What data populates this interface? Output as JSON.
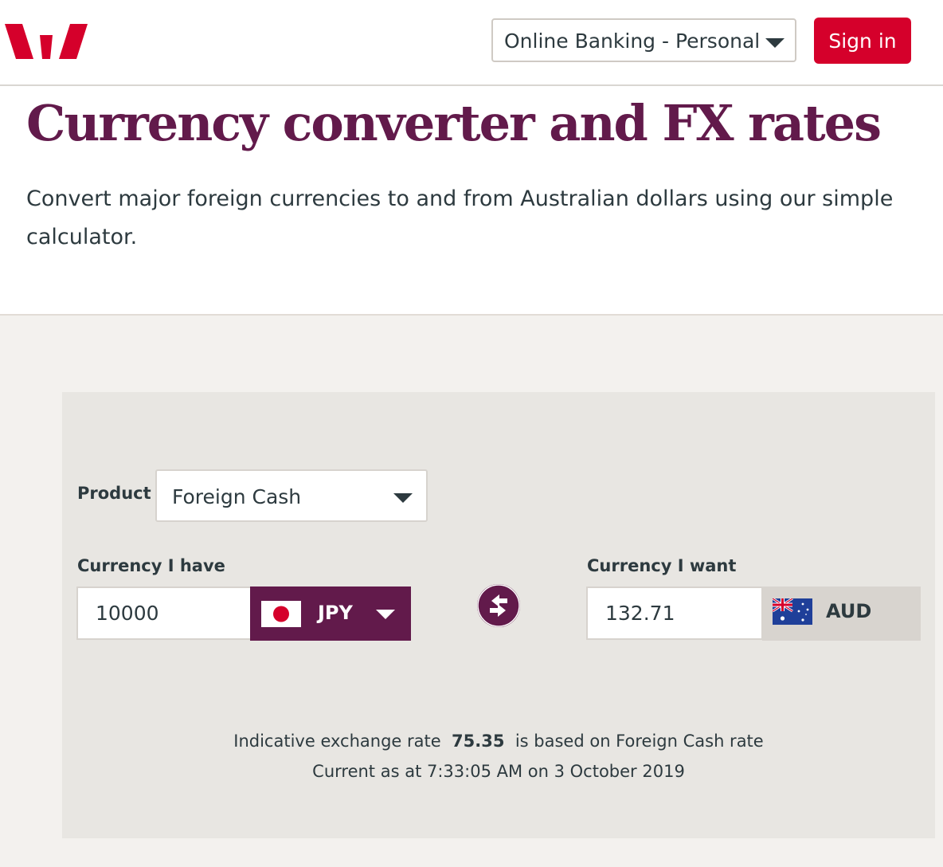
{
  "header": {
    "banking_select": "Online Banking - Personal",
    "sign_in": "Sign in",
    "colors": {
      "brand_red": "#d5002b",
      "brand_plum": "#621a4b"
    }
  },
  "page": {
    "title": "Currency converter and FX rates",
    "intro": "Convert major foreign currencies to and from Australian dollars using our simple calculator."
  },
  "converter": {
    "product_label": "Product",
    "product_value": "Foreign Cash",
    "have_label": "Currency I have",
    "have_amount": "10000",
    "have_currency": "JPY",
    "have_flag": "japan-flag-icon",
    "swap_icon": "swap-arrows-icon",
    "want_label": "Currency I want",
    "want_amount": "132.71",
    "want_currency": "AUD",
    "want_flag": "australia-flag-icon",
    "rate_prefix": "Indicative exchange rate",
    "rate_value": "75.35",
    "rate_suffix": "is based on Foreign Cash rate",
    "timestamp": "Current as at 7:33:05 AM on 3 October 2019"
  }
}
